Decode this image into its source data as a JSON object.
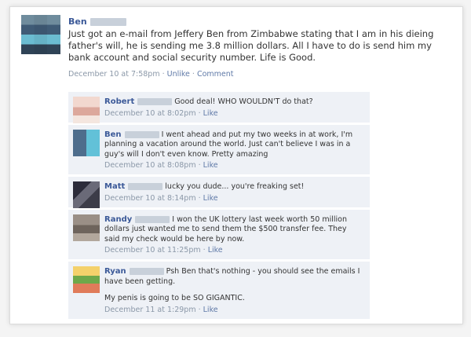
{
  "post": {
    "author_name": "Ben",
    "text": "Just got an e-mail from Jeffery Ben from Zimbabwe stating that I am in his dieing father's will, he is sending me 3.8 million dollars. All I have to do is send him my bank account and social security number. Life is Good.",
    "date": "December 10 at 7:58pm",
    "actions": [
      "Unlike",
      "Comment"
    ]
  },
  "comments": [
    {
      "name": "Robert",
      "text": "Good deal! WHO WOULDN'T do that?",
      "date": "December 10 at 8:02pm",
      "action": "Like"
    },
    {
      "name": "Ben",
      "text": "I went ahead and put my two weeks in at work, I'm planning a vacation around the world. Just can't believe I was in a guy's will I don't even know. Pretty amazing",
      "date": "December 10 at 8:08pm",
      "action": "Like"
    },
    {
      "name": "Matt",
      "text": "lucky you dude... you're freaking set!",
      "date": "December 10 at 8:14pm",
      "action": "Like"
    },
    {
      "name": "Randy",
      "text": "I won the UK lottery last week worth 50 million dollars just wanted me to send them the $500 transfer fee. They said my check would be here by now.",
      "date": "December 10 at 11:25pm",
      "action": "Like"
    },
    {
      "name": "Ryan",
      "text": "Psh Ben that's nothing - you should see the emails I have been getting.",
      "extra": "My penis is going to be SO GIGANTIC.",
      "date": "December 11 at 1:29pm",
      "action": "Like"
    }
  ]
}
